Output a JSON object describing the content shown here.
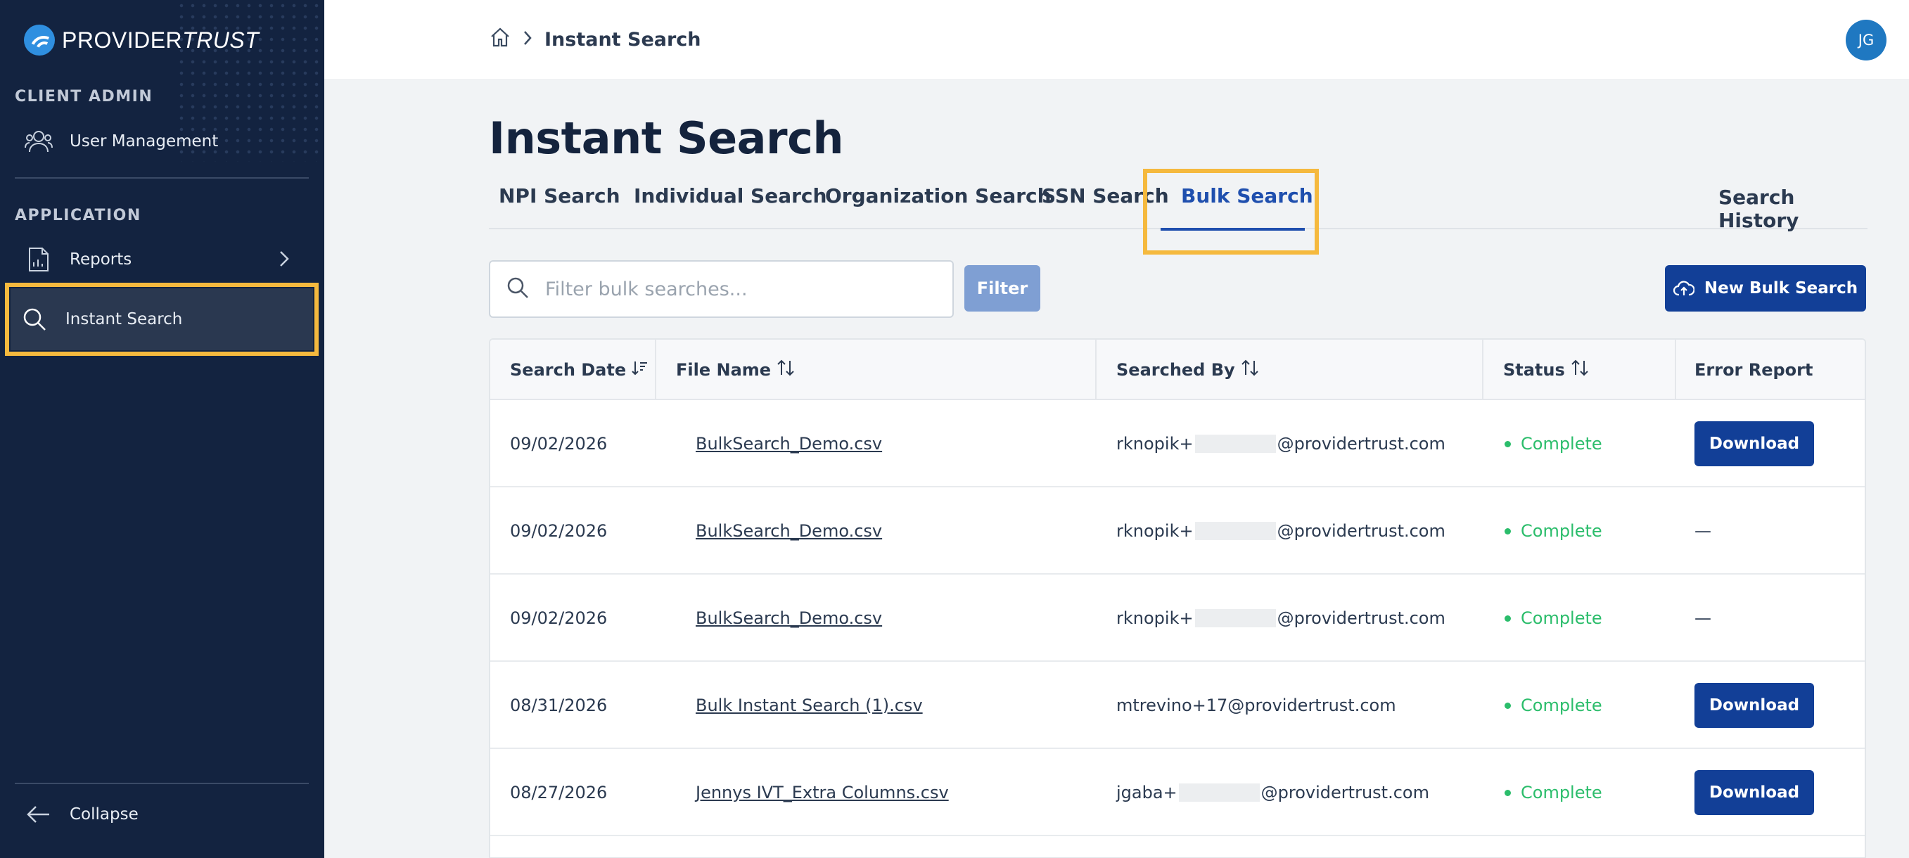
{
  "brand": {
    "name_part1": "PROVIDER",
    "name_part2": "TRUST"
  },
  "sidebar": {
    "section_admin": "CLIENT ADMIN",
    "user_management": "User Management",
    "section_app": "APPLICATION",
    "reports": "Reports",
    "instant_search": "Instant Search",
    "collapse": "Collapse"
  },
  "header": {
    "breadcrumb_current": "Instant Search",
    "avatar_initials": "JG"
  },
  "page": {
    "title": "Instant Search",
    "tabs": [
      "NPI Search",
      "Individual Search",
      "Organization Search",
      "SSN Search",
      "Bulk Search"
    ],
    "active_tab": "Bulk Search",
    "search_history": "Search History",
    "filter_placeholder": "Filter bulk searches...",
    "filter_button": "Filter",
    "new_button": "New Bulk Search"
  },
  "table": {
    "columns": [
      "Search Date",
      "File Name",
      "Searched By",
      "Status",
      "Error Report"
    ],
    "rows": [
      {
        "date": "09/02/2026",
        "file": "BulkSearch_Demo.csv",
        "by_prefix": "rknopik+",
        "by_suffix": "@providertrust.com",
        "redacted": true,
        "status": "Complete",
        "error": "Download"
      },
      {
        "date": "09/02/2026",
        "file": "BulkSearch_Demo.csv",
        "by_prefix": "rknopik+",
        "by_suffix": "@providertrust.com",
        "redacted": true,
        "status": "Complete",
        "error": "—"
      },
      {
        "date": "09/02/2026",
        "file": "BulkSearch_Demo.csv",
        "by_prefix": "rknopik+",
        "by_suffix": "@providertrust.com",
        "redacted": true,
        "status": "Complete",
        "error": "—"
      },
      {
        "date": "08/31/2026",
        "file": "Bulk Instant Search (1).csv",
        "by_prefix": "mtrevino+17@providertrust.com",
        "by_suffix": "",
        "redacted": false,
        "status": "Complete",
        "error": "Download"
      },
      {
        "date": "08/27/2026",
        "file": "Jennys IVT_Extra Columns.csv",
        "by_prefix": "jgaba+",
        "by_suffix": "@providertrust.com",
        "redacted": true,
        "status": "Complete",
        "error": "Download"
      }
    ]
  },
  "colors": {
    "sidebar_bg": "#132340",
    "primary": "#123f97",
    "highlight": "#f5b93e",
    "status_green": "#2bbd6b"
  }
}
